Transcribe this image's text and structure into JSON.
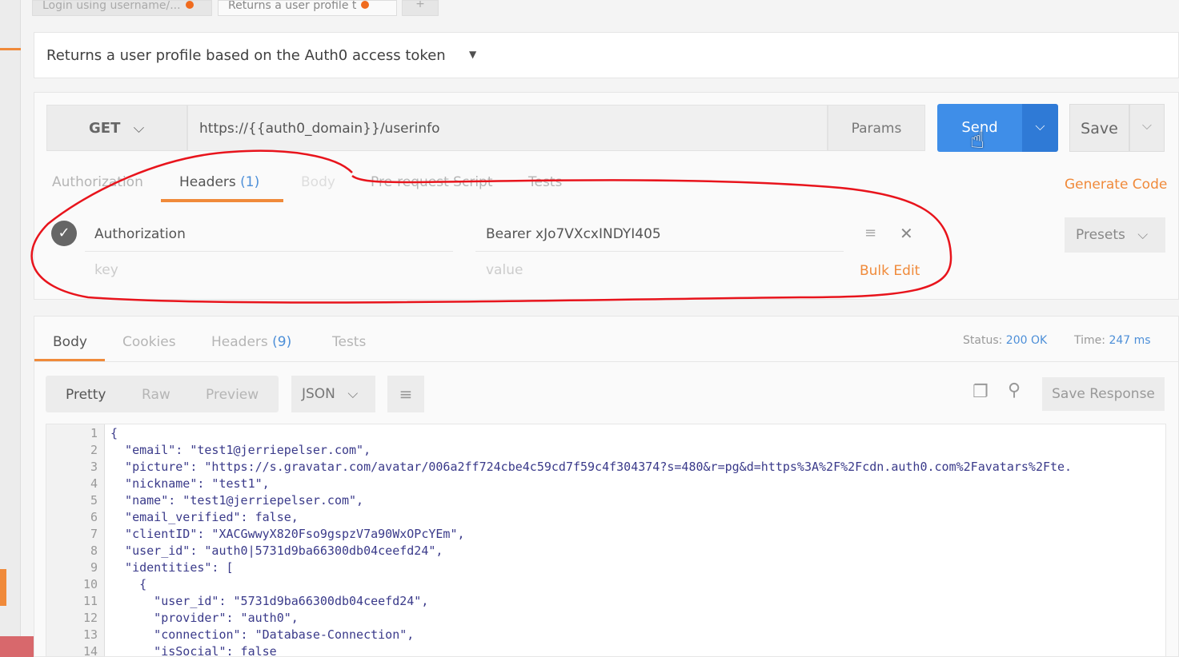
{
  "tabs": [
    {
      "label": "Login using username/..."
    },
    {
      "label": "Returns a user profile t"
    },
    {
      "label": "+"
    }
  ],
  "request": {
    "name": "Returns a user profile based on the Auth0 access token",
    "method": "GET",
    "url": "https://{{auth0_domain}}/userinfo",
    "params": "Params",
    "send": "Send",
    "save": "Save"
  },
  "req_tabs": {
    "authorization": "Authorization",
    "headers": "Headers",
    "headers_count": "(1)",
    "body": "Body",
    "prerequest": "Pre-request Script",
    "tests": "Tests",
    "generate_code": "Generate Code"
  },
  "header_row": {
    "key": "Authorization",
    "value": "Bearer xJo7VXcxINDYI405",
    "key_placeholder": "key",
    "value_placeholder": "value",
    "bulk_edit": "Bulk Edit",
    "presets": "Presets"
  },
  "resp_tabs": {
    "body": "Body",
    "cookies": "Cookies",
    "headers": "Headers",
    "headers_count": "(9)",
    "tests": "Tests",
    "status_label": "Status:",
    "status": "200 OK",
    "time_label": "Time:",
    "time": "247 ms"
  },
  "resp_toolbar": {
    "pretty": "Pretty",
    "raw": "Raw",
    "preview": "Preview",
    "format": "JSON",
    "save_response": "Save Response"
  },
  "code_lines": [
    {
      "n": "1",
      "t": "{"
    },
    {
      "n": "2",
      "t": "  \"email\": \"test1@jerriepelser.com\","
    },
    {
      "n": "3",
      "t": "  \"picture\": \"https://s.gravatar.com/avatar/006a2ff724cbe4c59cd7f59c4f304374?s=480&r=pg&d=https%3A%2F%2Fcdn.auth0.com%2Favatars%2Fte."
    },
    {
      "n": "4",
      "t": "  \"nickname\": \"test1\","
    },
    {
      "n": "5",
      "t": "  \"name\": \"test1@jerriepelser.com\","
    },
    {
      "n": "6",
      "t": "  \"email_verified\": false,"
    },
    {
      "n": "7",
      "t": "  \"clientID\": \"XACGwwyX820Fso9gspzV7a90WxOPcYEm\","
    },
    {
      "n": "8",
      "t": "  \"user_id\": \"auth0|5731d9ba66300db04ceefd24\","
    },
    {
      "n": "9",
      "t": "  \"identities\": ["
    },
    {
      "n": "10",
      "t": "    {"
    },
    {
      "n": "11",
      "t": "      \"user_id\": \"5731d9ba66300db04ceefd24\","
    },
    {
      "n": "12",
      "t": "      \"provider\": \"auth0\","
    },
    {
      "n": "13",
      "t": "      \"connection\": \"Database-Connection\","
    },
    {
      "n": "14",
      "t": "      \"isSocial\": false"
    }
  ],
  "colors": {
    "accent": "#f08a3a",
    "send": "#3f8ee8",
    "annotation": "#e8141c"
  }
}
